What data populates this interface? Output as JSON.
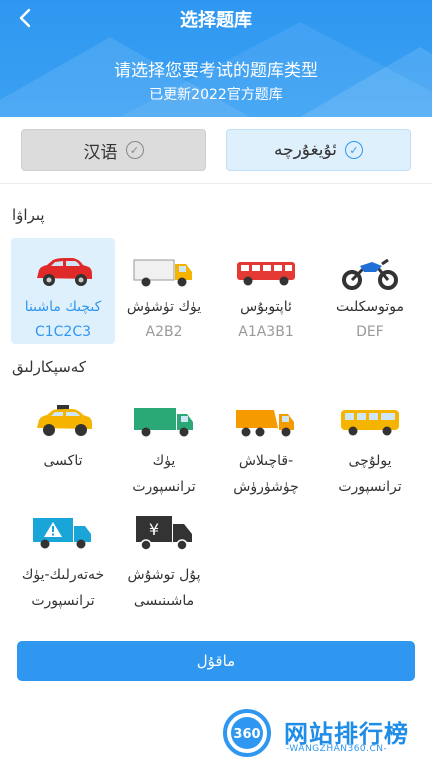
{
  "header": {
    "title": "选择题库",
    "subtitle": "请选择您要考试的题库类型",
    "update_note": "已更新2022官方题库"
  },
  "languages": {
    "chinese": {
      "label": "汉语",
      "selected": false
    },
    "uyghur": {
      "label": "ئۇيغۇرچە",
      "selected": true
    }
  },
  "sections": {
    "driver_label": "پىراۋا",
    "professional_label": "كەسپكارلىق"
  },
  "driver_items": [
    {
      "name": "كىچىك ماشىنا",
      "code": "C1C2C3",
      "icon": "car-icon",
      "color": "#e02a2a",
      "selected": true
    },
    {
      "name": "يۈك تۈشۈش",
      "code": "A2B2",
      "icon": "truck-icon",
      "color": "#f5b400",
      "selected": false
    },
    {
      "name": "ئاپتوبۇس",
      "code": "A1A3B1",
      "icon": "bus-icon",
      "color": "#e53935",
      "selected": false
    },
    {
      "name": "موتوسكلىت",
      "code": "DEF",
      "icon": "motorcycle-icon",
      "color": "#1f6fd6",
      "selected": false
    }
  ],
  "professional_items": [
    {
      "name1": "تاكسى",
      "name2": "",
      "icon": "taxi-icon",
      "color": "#f5b400"
    },
    {
      "name1": "يۈك",
      "name2": "ترانسپورت",
      "icon": "cargo-truck-icon",
      "color": "#2aa876"
    },
    {
      "name1": "قاچىلاش-",
      "name2": "چۈشۈرۈش",
      "icon": "dump-truck-icon",
      "color": "#f59b00"
    },
    {
      "name1": "يولۇچى",
      "name2": "ترانسپورت",
      "icon": "coach-bus-icon",
      "color": "#f5b400"
    },
    {
      "name1": "خەتەرلىك-يۈك",
      "name2": "ترانسپورت",
      "icon": "hazard-truck-icon",
      "color": "#1aa5d9"
    },
    {
      "name1": "پۇل توشۇش",
      "name2": "ماشىنىسى",
      "icon": "money-truck-icon",
      "color": "#333333"
    }
  ],
  "confirm_label": "ماقۇل",
  "watermark": {
    "logo_text": "360",
    "main": "网站排行榜",
    "sub": "-WANGZHAN360.CN-"
  },
  "colors": {
    "accent": "#2f97f0",
    "selected_bg": "#dff0fd"
  }
}
